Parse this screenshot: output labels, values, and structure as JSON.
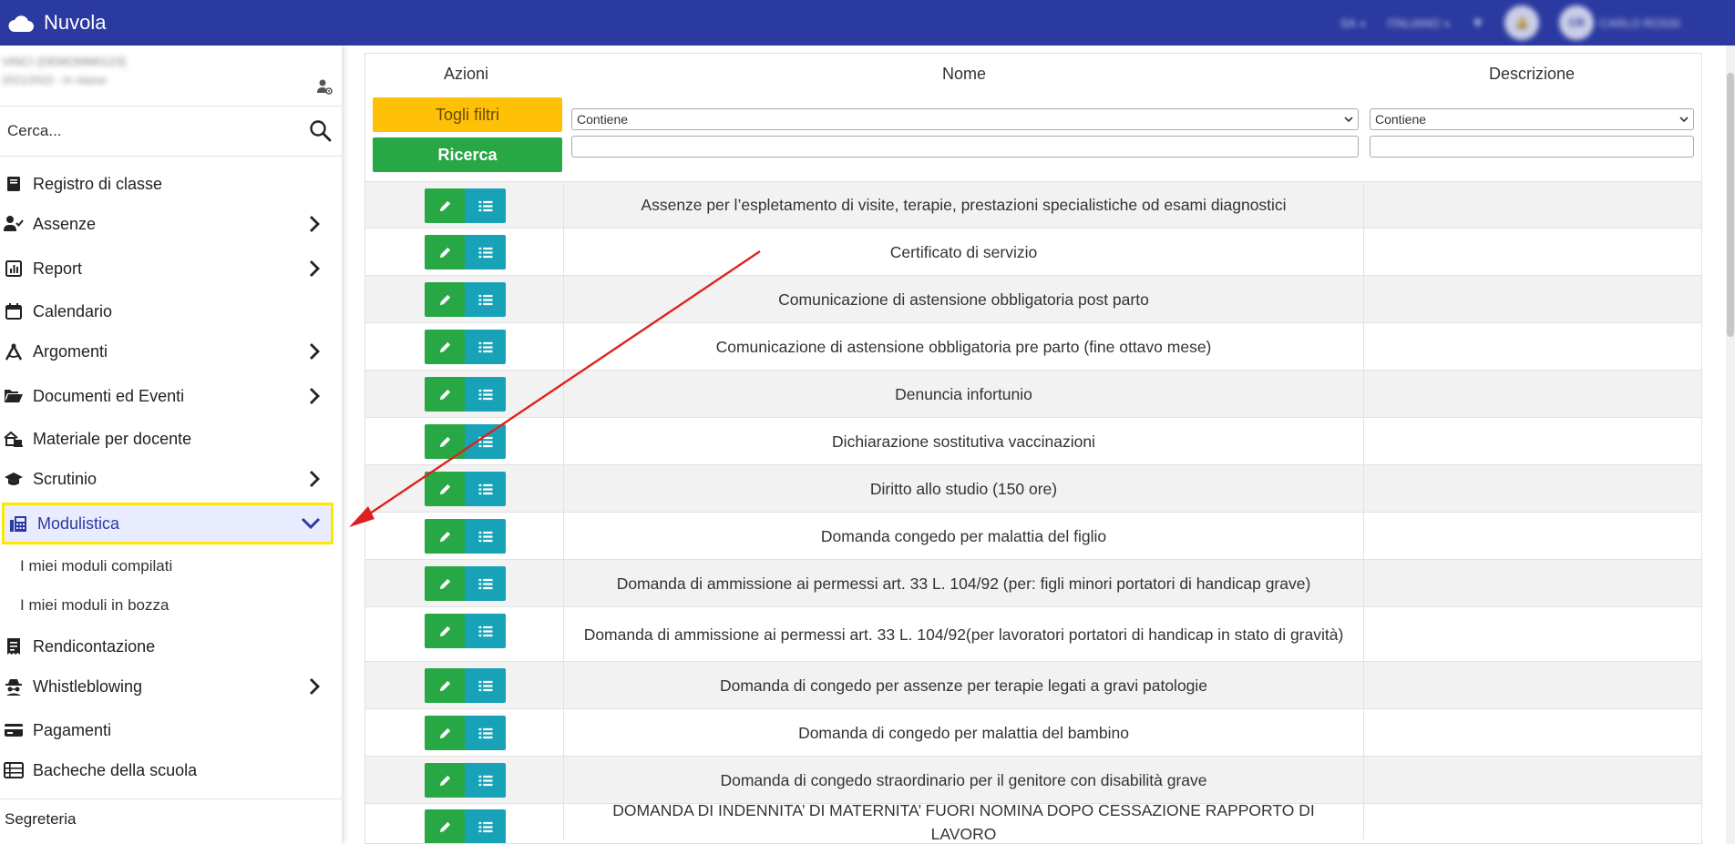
{
  "app": {
    "title": "Nuvola"
  },
  "topbar": {
    "school_code": "SA",
    "language": "ITALIANO",
    "user_initials": "CR",
    "user_name": "CARLO ROSSI"
  },
  "sidebar": {
    "user_line1": "VINCI (DEMOMM0123)",
    "user_line2": "2021/2022 - In classe",
    "search_placeholder": "Cerca...",
    "items": [
      {
        "label": "Registro di classe",
        "has_children": false
      },
      {
        "label": "Assenze",
        "has_children": true
      },
      {
        "label": "Report",
        "has_children": true
      },
      {
        "label": "Calendario",
        "has_children": false
      },
      {
        "label": "Argomenti",
        "has_children": true
      },
      {
        "label": "Documenti ed Eventi",
        "has_children": true
      },
      {
        "label": "Materiale per docente",
        "has_children": false
      },
      {
        "label": "Scrutinio",
        "has_children": true
      },
      {
        "label": "Modulistica",
        "has_children": true,
        "active": true
      },
      {
        "label": "Rendicontazione",
        "has_children": false
      },
      {
        "label": "Whistleblowing",
        "has_children": true
      },
      {
        "label": "Pagamenti",
        "has_children": false
      },
      {
        "label": "Bacheche della scuola",
        "has_children": false
      }
    ],
    "subitems": [
      "I miei moduli compilati",
      "I miei moduli in bozza"
    ],
    "footer_section": "Segreteria"
  },
  "table": {
    "headers": {
      "actions": "Azioni",
      "name": "Nome",
      "description": "Descrizione"
    },
    "remove_filters_label": "Togli filtri",
    "search_label": "Ricerca",
    "filter_name_mode": "Contiene",
    "filter_desc_mode": "Contiene",
    "rows": [
      {
        "name": "Assenze per l’espletamento di visite, terapie, prestazioni specialistiche od esami diagnostici",
        "description": ""
      },
      {
        "name": "Certificato di servizio",
        "description": ""
      },
      {
        "name": "Comunicazione di astensione obbligatoria post parto",
        "description": ""
      },
      {
        "name": "Comunicazione di astensione obbligatoria pre parto (fine ottavo mese)",
        "description": ""
      },
      {
        "name": "Denuncia infortunio",
        "description": ""
      },
      {
        "name": "Dichiarazione sostitutiva vaccinazioni",
        "description": ""
      },
      {
        "name": "Diritto allo studio (150 ore)",
        "description": ""
      },
      {
        "name": "Domanda congedo per malattia del figlio",
        "description": ""
      },
      {
        "name": "Domanda di ammissione ai permessi art. 33 L. 104/92 (per: figli minori portatori di handicap grave)",
        "description": ""
      },
      {
        "name": "Domanda di ammissione ai permessi art. 33 L. 104/92(per lavoratori portatori di handicap in stato di gravità)",
        "description": ""
      },
      {
        "name": "Domanda di congedo per assenze per terapie legati a gravi patologie",
        "description": ""
      },
      {
        "name": "Domanda di congedo per malattia del bambino",
        "description": ""
      },
      {
        "name": "Domanda di congedo straordinario per il genitore con disabilità grave",
        "description": ""
      },
      {
        "name": "DOMANDA DI INDENNITA’ DI MATERNITA’ FUORI NOMINA DOPO CESSAZIONE RAPPORTO DI LAVORO",
        "description": ""
      }
    ]
  },
  "colors": {
    "topbar": "#2b3aa0",
    "edit_button": "#28a745",
    "list_button": "#17a2b8",
    "remove_filters_button": "#ffc107",
    "highlight_border": "#ffe600",
    "annotation_arrow": "#e02020"
  }
}
